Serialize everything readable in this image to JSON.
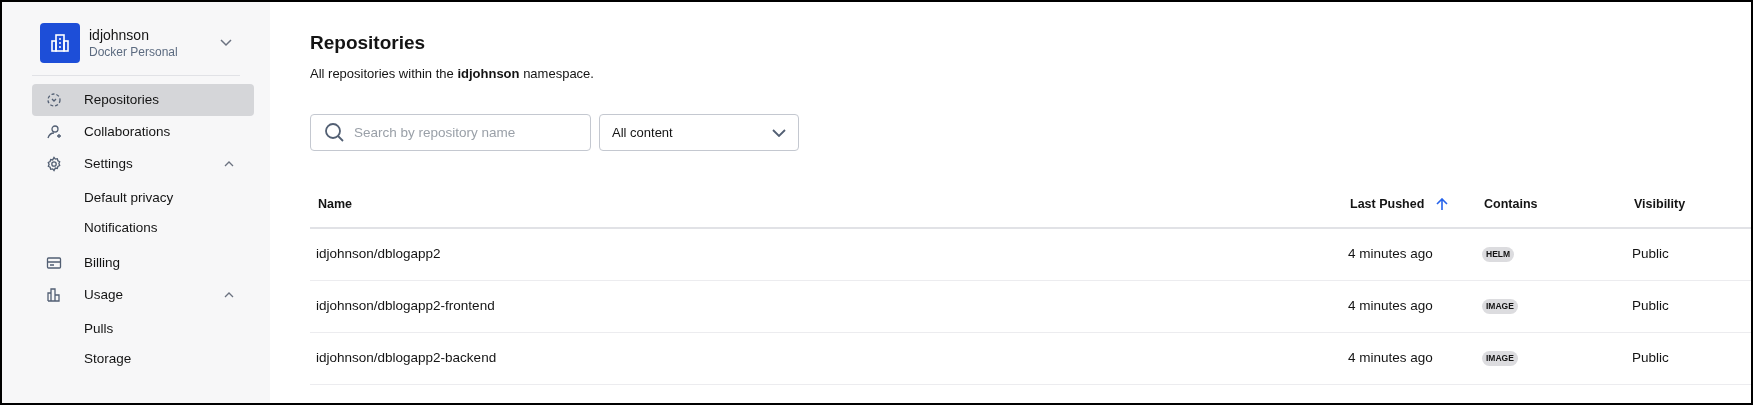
{
  "account": {
    "name": "idjohnson",
    "plan": "Docker Personal"
  },
  "sidebar": {
    "items": [
      {
        "label": "Repositories",
        "selected": true
      },
      {
        "label": "Collaborations",
        "selected": false
      },
      {
        "label": "Settings",
        "selected": false,
        "expanded": true,
        "children": [
          {
            "label": "Default privacy",
            "selected": false
          },
          {
            "label": "Notifications",
            "selected": false
          }
        ]
      },
      {
        "label": "Billing",
        "selected": false
      },
      {
        "label": "Usage",
        "selected": false,
        "expanded": true,
        "children": [
          {
            "label": "Pulls",
            "selected": false
          },
          {
            "label": "Storage",
            "selected": false
          }
        ]
      }
    ]
  },
  "page": {
    "title": "Repositories",
    "description": "All repositories within the **idjohnson** namespace."
  },
  "search": {
    "placeholder": "Search by repository name"
  },
  "filter": {
    "value": "All content"
  },
  "table": {
    "columns": [
      {
        "label": "Name",
        "sorted": false
      },
      {
        "label": "Last Pushed",
        "sorted": true
      },
      {
        "label": "Contains",
        "sorted": false
      },
      {
        "label": "Visibility",
        "sorted": false
      }
    ],
    "rows": [
      {
        "name": "idjohnson/dblogapp2",
        "last_pushed": "4 minutes ago",
        "contains": "HELM",
        "visibility": "Public"
      },
      {
        "name": "idjohnson/dblogapp2-frontend",
        "last_pushed": "4 minutes ago",
        "contains": "IMAGE",
        "visibility": "Public"
      },
      {
        "name": "idjohnson/dblogapp2-backend",
        "last_pushed": "4 minutes ago",
        "contains": "IMAGE",
        "visibility": "Public"
      }
    ]
  }
}
